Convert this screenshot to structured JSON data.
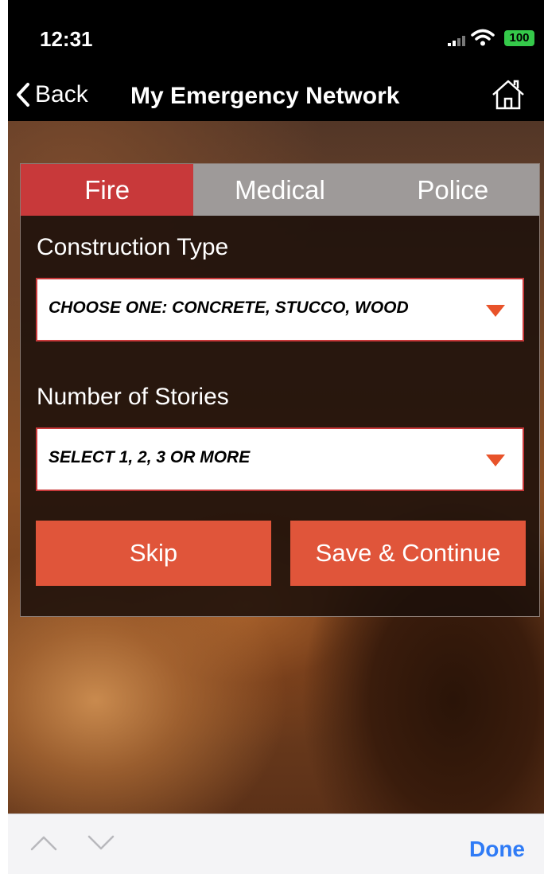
{
  "status_bar": {
    "time": "12:31",
    "battery": "100"
  },
  "nav": {
    "back_label": "Back",
    "title": "My Emergency Network"
  },
  "tabs": [
    {
      "label": "Fire",
      "active": true
    },
    {
      "label": "Medical",
      "active": false
    },
    {
      "label": "Police",
      "active": false
    }
  ],
  "form": {
    "construction_label": "Construction Type",
    "construction_value": "CHOOSE ONE: CONCRETE, STUCCO, WOOD",
    "stories_label": "Number of Stories",
    "stories_value": "SELECT 1, 2, 3 OR MORE"
  },
  "buttons": {
    "skip": "Skip",
    "save": "Save & Continue"
  },
  "accessory": {
    "done": "Done"
  },
  "colors": {
    "accent": "#c8393a",
    "button": "#e0553a",
    "tab_inactive": "#9e9a99",
    "link": "#2f7bf6"
  }
}
